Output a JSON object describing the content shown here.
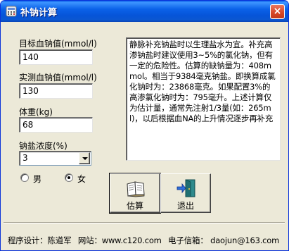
{
  "window": {
    "title": "补钠计算",
    "close_glyph": "×"
  },
  "fields": {
    "target_label": "目标血钠值(mmol/l)",
    "target_value": "140",
    "measured_label": "实测血钠值(mmol/l)",
    "measured_value": "130",
    "weight_label": "体重(kg)",
    "weight_value": "68",
    "concentration_label": "钠盐浓度(%)",
    "concentration_value": "3"
  },
  "gender": {
    "male_label": "男",
    "female_label": "女",
    "selected": "女"
  },
  "result_text": "静脉补充钠盐时以生理盐水为宜。补充高渗钠盐时建议使用3~5%的氯化钠，但有一定的危险性。估算的缺钠量为：408mmol。相当于9384毫克钠盐。即换算成氯化钠时为：23868毫克。如果配置3%的高渗氯化钠时为：795毫升。上述计算仅为估计量，通常先注射1/3量(如：265ml)，以后根据血NA的上升情况逐步再补充",
  "buttons": {
    "estimate_label": "估算",
    "estimate_icon": "open-book-icon",
    "exit_label": "退出",
    "exit_icon": "exit-door-icon"
  },
  "status": {
    "designer": "程序设计：陈道军",
    "website": "网站：www.c120.com",
    "email": "电子信箱： daojun@163.com"
  },
  "colors": {
    "titlebar": "#0b5fe5",
    "face": "#ece9d8"
  }
}
